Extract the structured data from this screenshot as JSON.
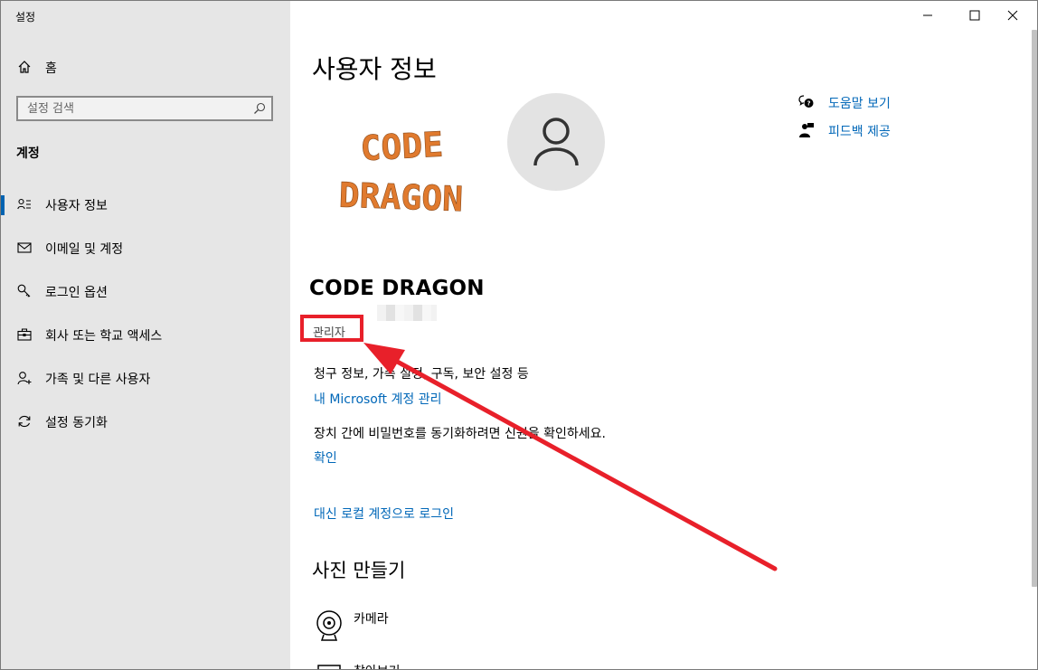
{
  "window": {
    "title": "설정",
    "controls": {
      "minimize": "minimize",
      "maximize": "maximize",
      "close": "close"
    }
  },
  "sidebar": {
    "home_label": "홈",
    "search_placeholder": "설정 검색",
    "section_title": "계정",
    "items": [
      {
        "label": "사용자 정보",
        "icon": "user-info-icon",
        "active": true
      },
      {
        "label": "이메일 및 계정",
        "icon": "mail-icon",
        "active": false
      },
      {
        "label": "로그인 옵션",
        "icon": "key-icon",
        "active": false
      },
      {
        "label": "회사 또는 학교 액세스",
        "icon": "briefcase-icon",
        "active": false
      },
      {
        "label": "가족 및 다른 사용자",
        "icon": "person-add-icon",
        "active": false
      },
      {
        "label": "설정 동기화",
        "icon": "sync-icon",
        "active": false
      }
    ]
  },
  "main": {
    "page_title": "사용자 정보",
    "help": {
      "label": "도움말 보기",
      "icon": "help-chat-icon"
    },
    "feedback": {
      "label": "피드백 제공",
      "icon": "feedback-icon"
    },
    "logo": {
      "line1": "CODE",
      "line2": "DRAGON"
    },
    "user_name": "CODE DRAGON",
    "role": "관리자",
    "account_desc": "청구 정보, 가족 설정, 구독, 보안 설정 등",
    "manage_account_link": "내 Microsoft 계정 관리",
    "sync_desc": "장치 간에 비밀번호를 동기화하려면 신원을 확인하세요.",
    "verify_link": "확인",
    "local_signin_link": "대신 로컬 계정으로 로그인",
    "create_photo_title": "사진 만들기",
    "camera_label": "카메라",
    "browse_label": "찾아보기"
  },
  "colors": {
    "sidebar_bg": "#e6e6e6",
    "accent": "#0063b1",
    "link": "#0067b8",
    "highlight_red": "#e8202a",
    "logo_orange": "#e07a2e"
  }
}
